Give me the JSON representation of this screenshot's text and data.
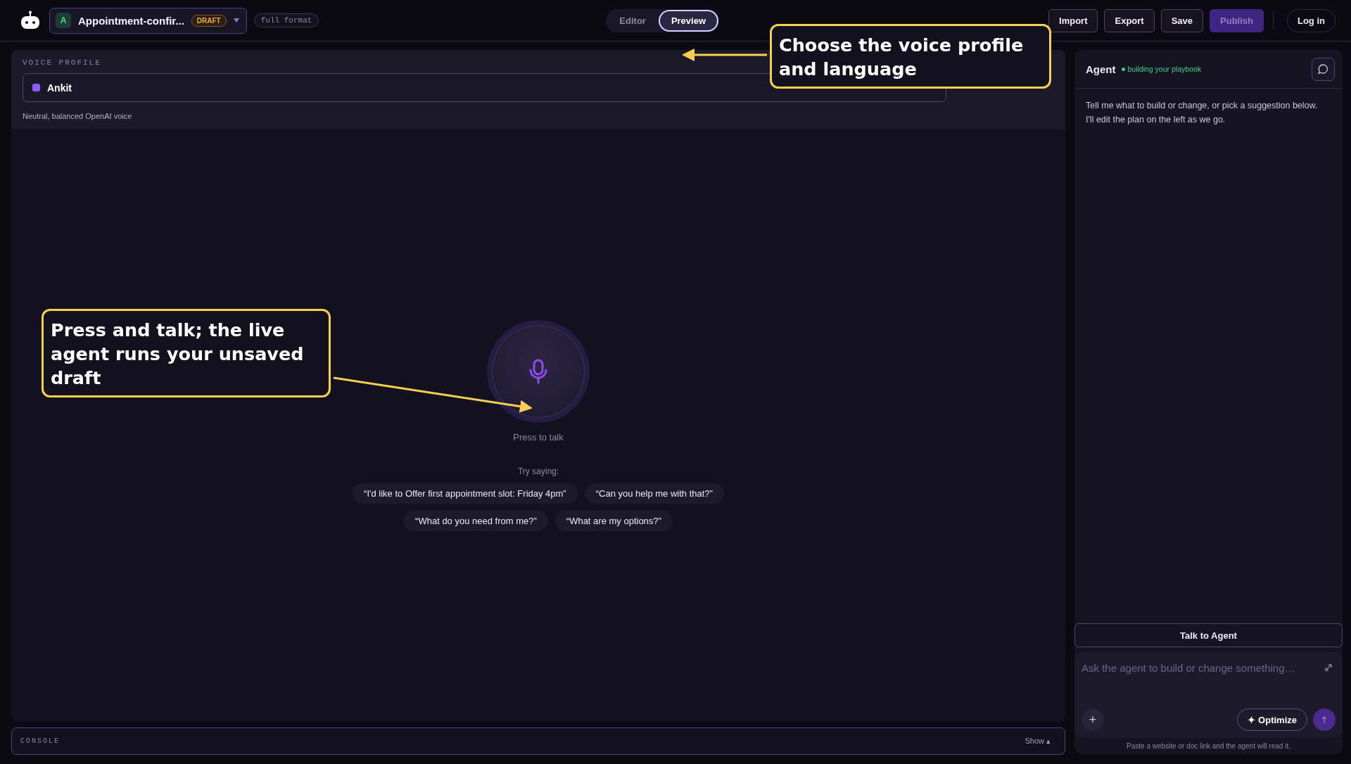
{
  "header": {
    "project": {
      "initial": "A",
      "name": "Appointment-confir...",
      "status": "DRAFT"
    },
    "format": "full format",
    "view_tabs": [
      {
        "label": "Editor",
        "selected": false
      },
      {
        "label": "Preview",
        "selected": true
      }
    ],
    "actions": [
      {
        "label": "Import",
        "kind": "outline"
      },
      {
        "label": "Export",
        "kind": "outline"
      },
      {
        "label": "Save",
        "kind": "outline"
      },
      {
        "label": "Publish",
        "kind": "primary"
      }
    ],
    "login": "Log in"
  },
  "voice_profile": {
    "heading": "VOICE PROFILE",
    "voice": {
      "name": "Ankit",
      "color": "#8b5cf6"
    },
    "description": "Neutral, balanced OpenAI voice"
  },
  "talk": {
    "label": "Press to talk",
    "hint": "Try saying:",
    "suggestions": [
      "“I'd like to Offer first appointment slot: Friday 4pm”",
      "“Can you help me with that?”",
      "“What do you need from me?”",
      "“What are my options?”"
    ]
  },
  "console": {
    "label": "CONSOLE",
    "toggle": "Show ▴"
  },
  "agent": {
    "title": "Agent",
    "status": "building your playbook",
    "intro": "Tell me what to build or change, or pick a suggestion below. I'll edit the plan on the left as we go.",
    "talk_button": "Talk to Agent",
    "composer": {
      "placeholder": "Ask the agent to build or change something…",
      "add": "+",
      "optimize": "✦ Optimize",
      "footer": "Paste a website or doc link and the agent will read it."
    }
  },
  "annotations": [
    {
      "text": "Choose the voice profile and language"
    },
    {
      "text": "Press and talk; the live agent runs your unsaved draft"
    }
  ]
}
